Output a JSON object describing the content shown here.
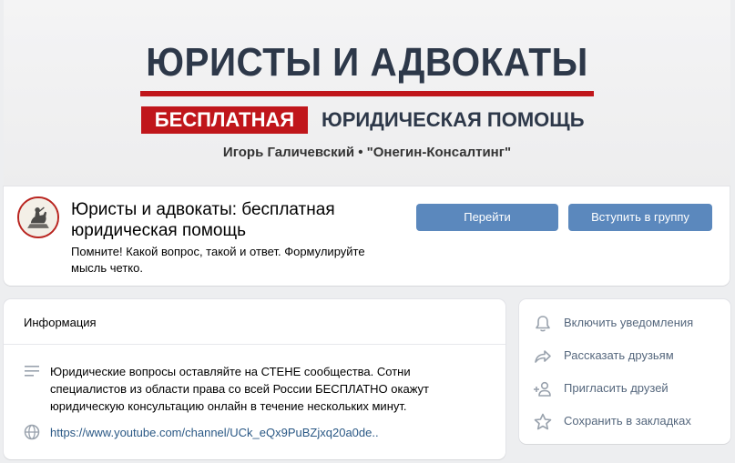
{
  "cover": {
    "title": "ЮРИСТЫ И АДВОКАТЫ",
    "badge": "БЕСПЛАТНАЯ",
    "subtitle": "ЮРИДИЧЕСКАЯ ПОМОЩЬ",
    "authors": "Игорь Галичевский • \"Онегин-Консалтинг\"",
    "accent_color": "#c0161b",
    "text_color": "#2d3849"
  },
  "group": {
    "name": "Юристы и адвокаты: бесплатная юридическая помощь",
    "status": "Помните! Какой вопрос, такой и ответ. Формулируйте мысль четко.",
    "go_button": "Перейти",
    "join_button": "Вступить в группу",
    "button_color": "#5b88bd"
  },
  "info": {
    "title": "Информация",
    "description": "Юридические вопросы оставляйте на СТЕНЕ сообщества. Сотни специалистов из области права со всей России БЕСПЛАТНО окажут юридическую консультацию онлайн в течение нескольких минут.",
    "link": "https://www.youtube.com/channel/UCk_eQx9PuBZjxq20a0de..",
    "link_color": "#2a5885"
  },
  "actions": [
    {
      "label": "Включить уведомления",
      "icon": "bell-icon"
    },
    {
      "label": "Рассказать друзьям",
      "icon": "share-icon"
    },
    {
      "label": "Пригласить друзей",
      "icon": "add-user-icon"
    },
    {
      "label": "Сохранить в закладках",
      "icon": "star-icon"
    }
  ]
}
